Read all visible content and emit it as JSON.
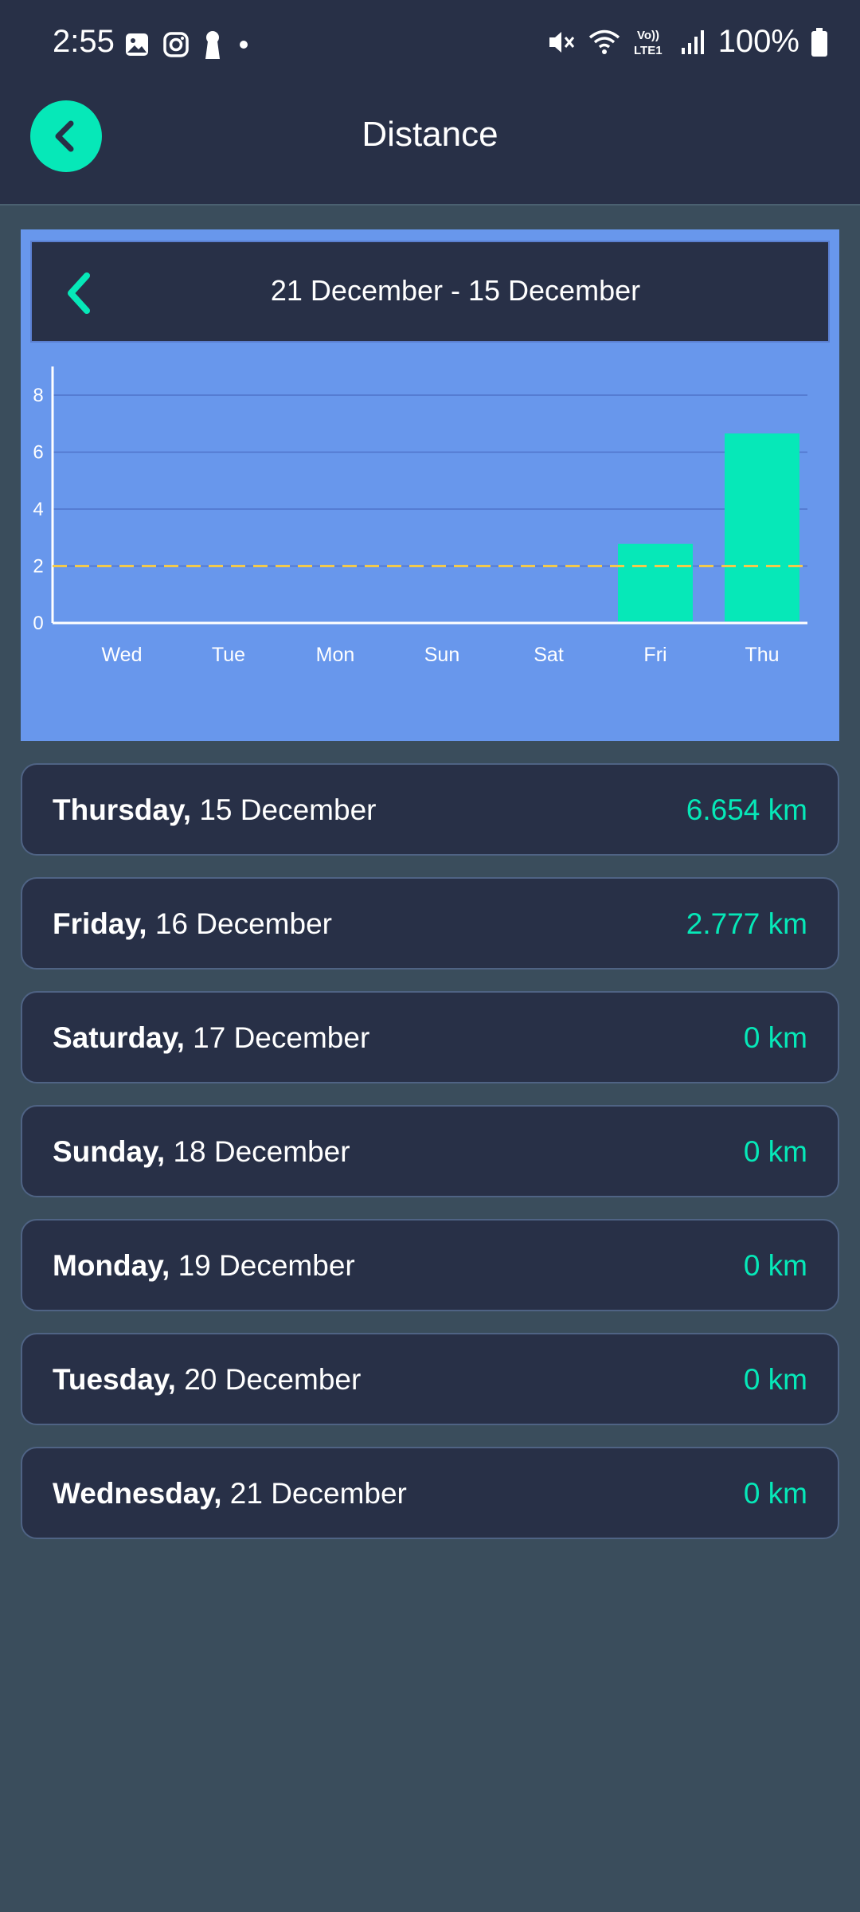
{
  "status_bar": {
    "time": "2:55",
    "battery": "100%",
    "network": "LTE1"
  },
  "app_bar": {
    "title": "Distance",
    "back_icon": "chevron-left-icon"
  },
  "range": {
    "label": "21 December - 15 December",
    "prev_icon": "chevron-left-icon"
  },
  "colors": {
    "accent": "#06e8b8",
    "chart_bg": "#6897ec",
    "goal_line": "#f2c94c",
    "card_bg": "#283047",
    "page_bg": "#3a4d5c"
  },
  "chart_data": {
    "type": "bar",
    "categories": [
      "Wed",
      "Tue",
      "Mon",
      "Sun",
      "Sat",
      "Fri",
      "Thu"
    ],
    "values": [
      0,
      0,
      0,
      0,
      0,
      2.777,
      6.654
    ],
    "ylim": [
      0,
      9
    ],
    "yticks": [
      0,
      2,
      4,
      6,
      8
    ],
    "goal_line": 2,
    "grid": true
  },
  "days": [
    {
      "name": "Thursday,",
      "date": "15 December",
      "value": "6.654 km"
    },
    {
      "name": "Friday,",
      "date": "16 December",
      "value": "2.777 km"
    },
    {
      "name": "Saturday,",
      "date": "17 December",
      "value": "0 km"
    },
    {
      "name": "Sunday,",
      "date": "18 December",
      "value": "0 km"
    },
    {
      "name": "Monday,",
      "date": "19 December",
      "value": "0 km"
    },
    {
      "name": "Tuesday,",
      "date": "20 December",
      "value": "0 km"
    },
    {
      "name": "Wednesday,",
      "date": "21 December",
      "value": "0 km"
    }
  ]
}
